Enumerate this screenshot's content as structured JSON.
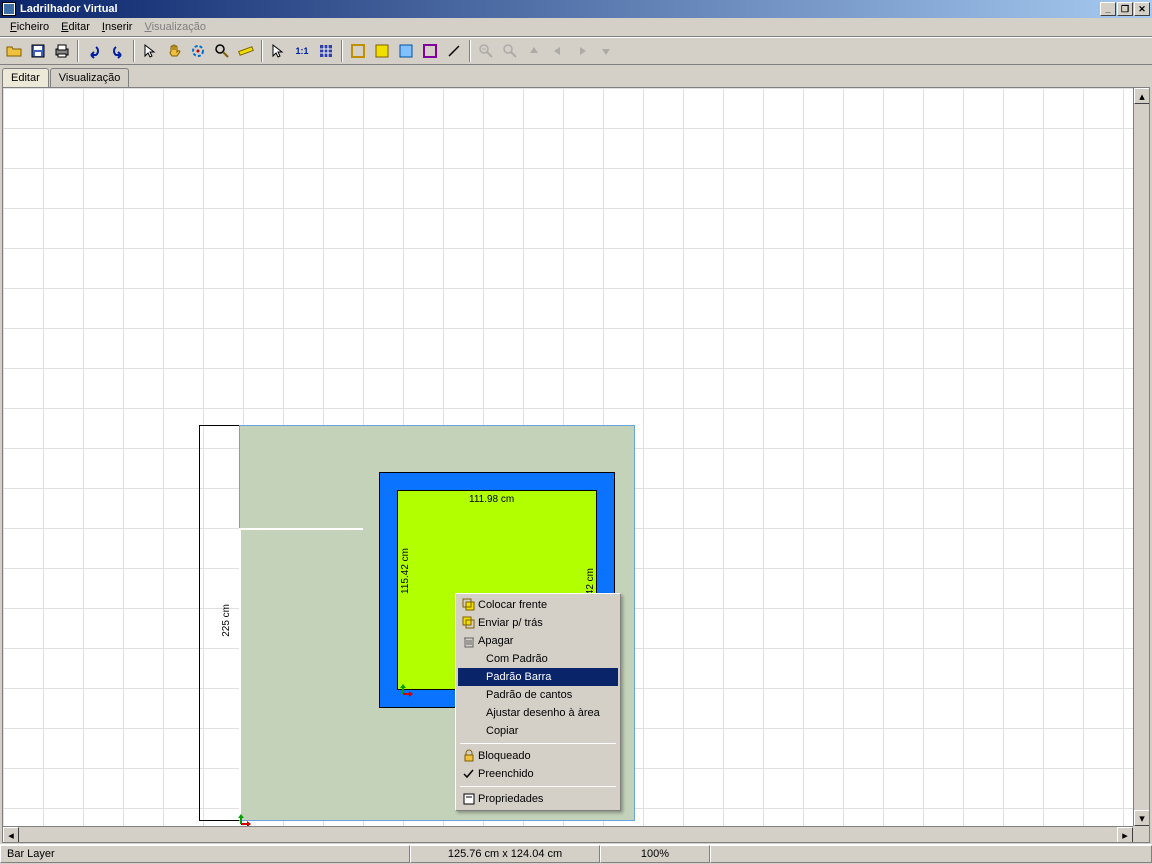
{
  "window": {
    "title": "Ladrilhador Virtual"
  },
  "menu": {
    "ficheiro": "Ficheiro",
    "editar": "Editar",
    "inserir": "Inserir",
    "visualizacao": "Visualização"
  },
  "tabs": {
    "editar": "Editar",
    "visualizacao": "Visualização"
  },
  "dimensions": {
    "width_top": "111.98 cm",
    "height_left": "115.42 cm",
    "height_right": "42 cm",
    "outer_height": "225 cm"
  },
  "context_menu": {
    "colocar_frente": "Colocar frente",
    "enviar_tras": "Enviar p/ trás",
    "apagar": "Apagar",
    "com_padrao": "Com Padrão",
    "padrao_barra": "Padrão Barra",
    "padrao_cantos": "Padrão de cantos",
    "ajustar_area": "Ajustar desenho à àrea",
    "copiar": "Copiar",
    "bloqueado": "Bloqueado",
    "preenchido": "Preenchido",
    "propriedades": "Propriedades"
  },
  "status": {
    "layer": "Bar Layer",
    "dims": "125.76 cm x 124.04 cm",
    "zoom": "100%"
  }
}
